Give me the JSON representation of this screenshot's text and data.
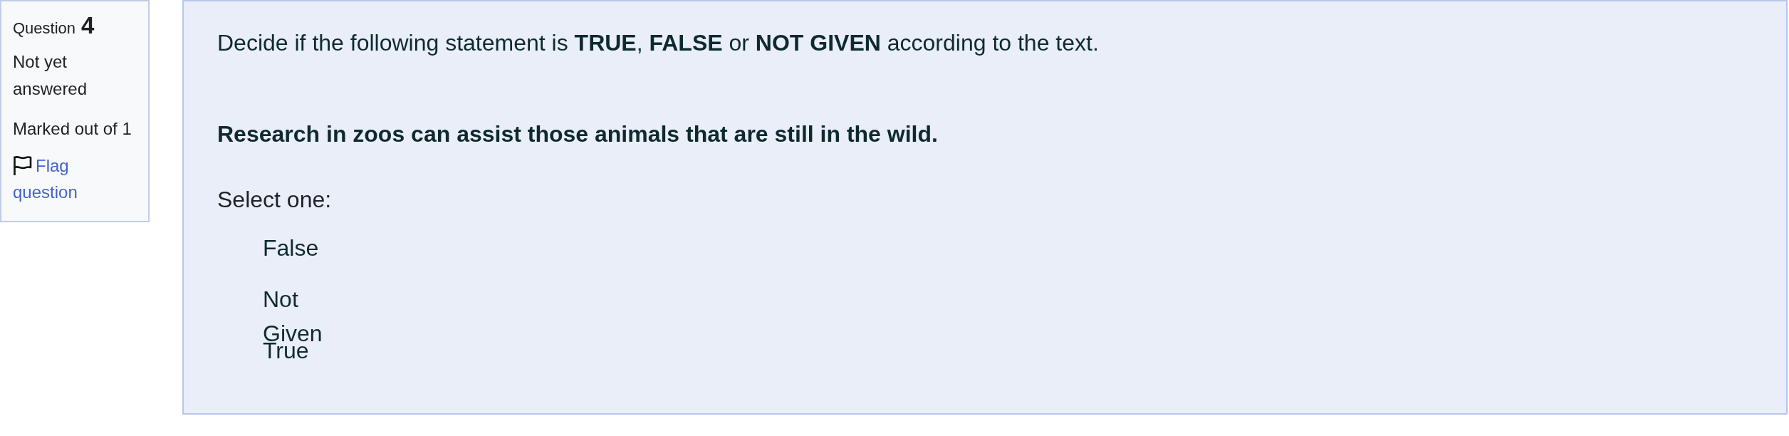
{
  "question_info": {
    "label": "Question",
    "number": "4",
    "state": "Not yet answered",
    "grade": "Marked out of 1",
    "flag_link": "Flag question"
  },
  "question": {
    "instruction": "Decide if the following statement is **TRUE**, **FALSE** or **NOT GIVEN** according to the text.",
    "statement": "Research in zoos can assist those animals that are still in the wild.",
    "prompt": "Select one:",
    "options": [
      {
        "label": "False"
      },
      {
        "label": "Not Given"
      },
      {
        "label": "True"
      }
    ]
  }
}
